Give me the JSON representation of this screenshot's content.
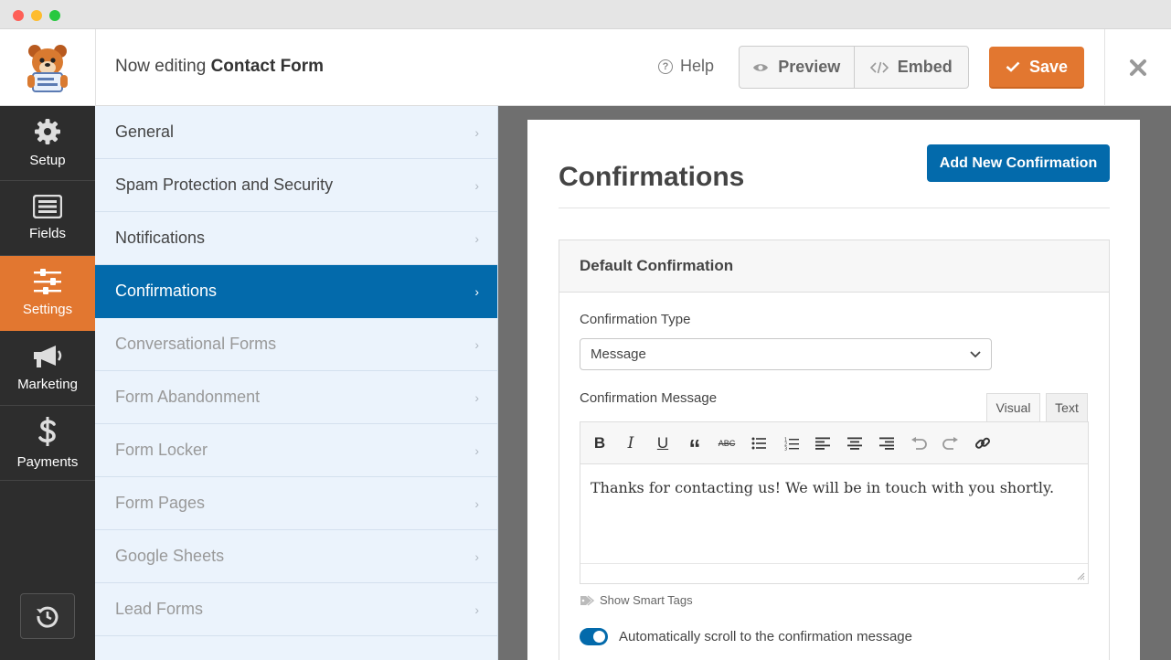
{
  "header": {
    "editing_prefix": "Now editing",
    "form_name": "Contact Form",
    "help_label": "Help",
    "preview_label": "Preview",
    "embed_label": "Embed",
    "save_label": "Save"
  },
  "sidebar": {
    "items": [
      {
        "label": "Setup",
        "icon": "gear-icon"
      },
      {
        "label": "Fields",
        "icon": "fields-icon"
      },
      {
        "label": "Settings",
        "icon": "sliders-icon"
      },
      {
        "label": "Marketing",
        "icon": "megaphone-icon"
      },
      {
        "label": "Payments",
        "icon": "dollar-icon"
      }
    ],
    "active": "Settings"
  },
  "panel": {
    "items": [
      {
        "label": "General"
      },
      {
        "label": "Spam Protection and Security"
      },
      {
        "label": "Notifications"
      },
      {
        "label": "Confirmations"
      },
      {
        "label": "Conversational Forms"
      },
      {
        "label": "Form Abandonment"
      },
      {
        "label": "Form Locker"
      },
      {
        "label": "Form Pages"
      },
      {
        "label": "Google Sheets"
      },
      {
        "label": "Lead Forms"
      }
    ],
    "active": "Confirmations"
  },
  "main": {
    "title": "Confirmations",
    "add_button": "Add New Confirmation",
    "confirmation": {
      "heading": "Default Confirmation",
      "type_label": "Confirmation Type",
      "type_value": "Message",
      "message_label": "Confirmation Message",
      "tab_visual": "Visual",
      "tab_text": "Text",
      "message": "Thanks for contacting us! We will be in touch with you shortly.",
      "smart_tags": "Show Smart Tags",
      "auto_scroll_label": "Automatically scroll to the confirmation message",
      "auto_scroll_enabled": true
    }
  },
  "colors": {
    "accent_orange": "#e27730",
    "accent_blue": "#036aab",
    "sidebar_dark": "#2d2d2d",
    "panel_bg": "#ebf3fc"
  }
}
